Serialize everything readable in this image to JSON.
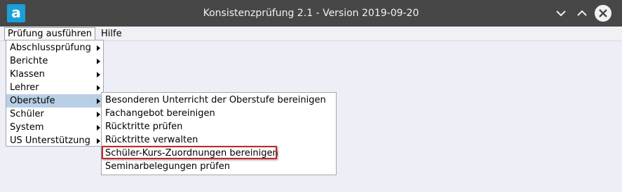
{
  "window": {
    "title": "Konsistenzprüfung 2.1 - Version 2019-09-20",
    "logo_letter": "a",
    "controls": [
      "chevron-down-icon",
      "chevron-up-icon",
      "close-icon"
    ]
  },
  "menubar": {
    "items": [
      "Prüfung ausführen",
      "Hilfe"
    ]
  },
  "dropdown": {
    "items": [
      {
        "label": "Abschlussprüfung",
        "has_submenu": true
      },
      {
        "label": "Berichte",
        "has_submenu": true
      },
      {
        "label": "Klassen",
        "has_submenu": true
      },
      {
        "label": "Lehrer",
        "has_submenu": true
      },
      {
        "label": "Oberstufe",
        "has_submenu": true,
        "active": true
      },
      {
        "label": "Schüler",
        "has_submenu": true
      },
      {
        "label": "System",
        "has_submenu": true
      },
      {
        "label": "US Unterstützung",
        "has_submenu": true
      }
    ]
  },
  "submenu": {
    "items": [
      "Besonderen Unterricht der Oberstufe bereinigen",
      "Fachangebot bereinigen",
      "Rücktritte prüfen",
      "Rücktritte verwalten",
      "Schüler-Kurs-Zuordnungen bereinigen",
      "Seminarbelegungen prüfen"
    ],
    "highlighted_item": "Schüler-Kurs-Zuordnungen bereinigen"
  },
  "colors": {
    "titlebar": "#474747",
    "background": "#eeeef7",
    "active_item": "#b8cfe6",
    "highlight_border": "#c0282d",
    "logo": "#1aa0d8"
  }
}
